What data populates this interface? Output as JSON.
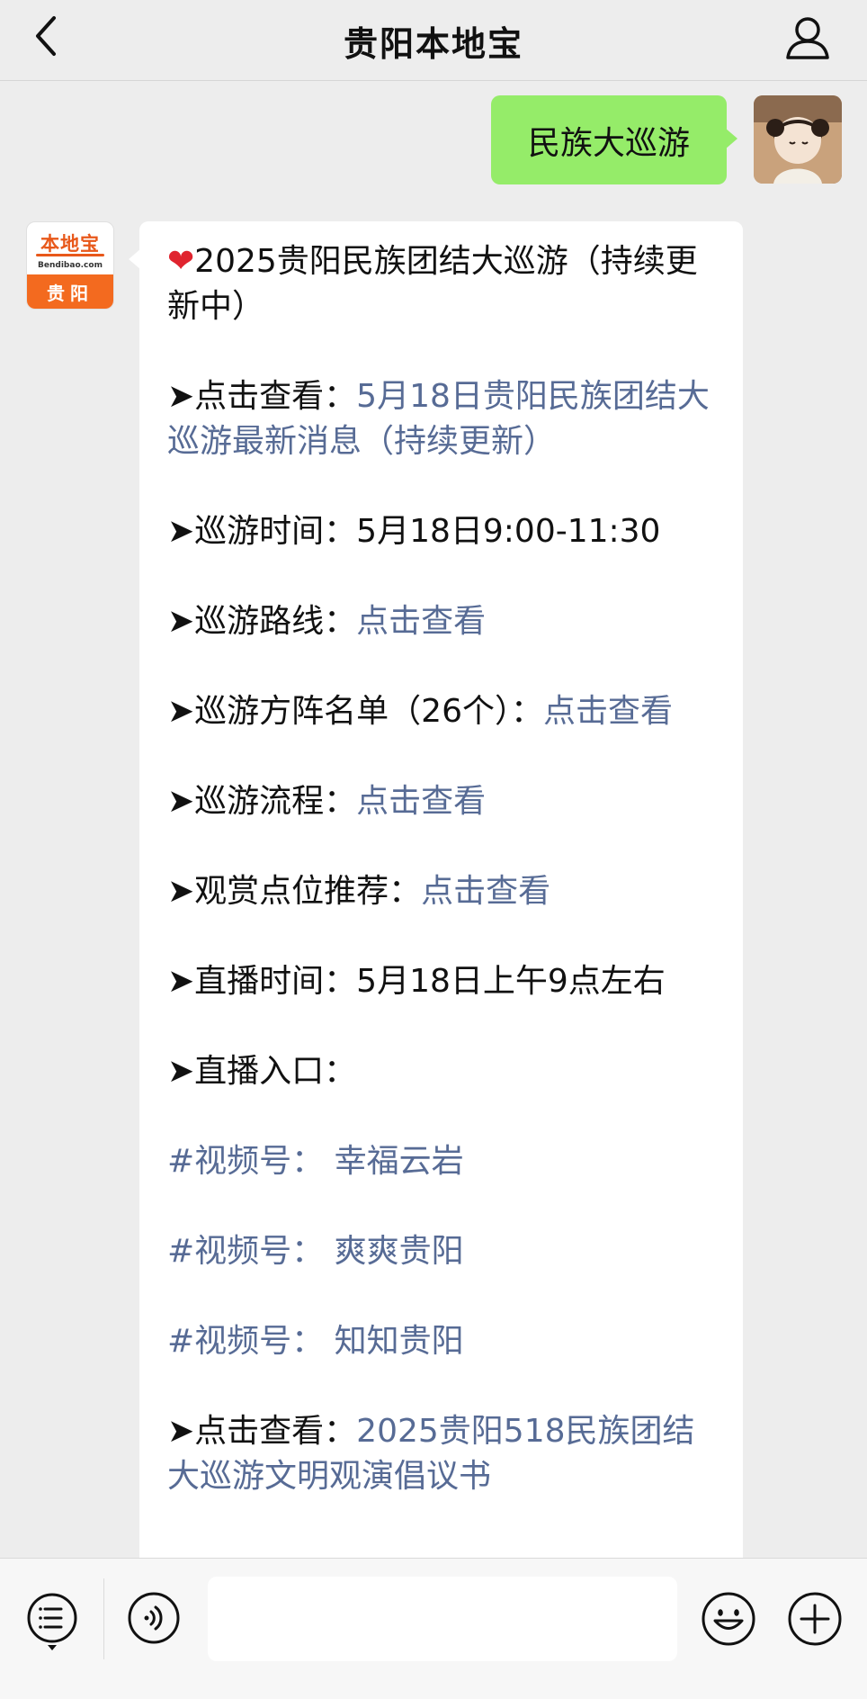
{
  "header": {
    "title": "贵阳本地宝"
  },
  "outgoing": {
    "text": "民族大巡游"
  },
  "incoming": {
    "avatar": {
      "logo_top": "本地宝",
      "logo_sub": "Bendibao.com",
      "logo_bottom": "贵阳"
    },
    "heading": "2025贵阳民族团结大巡游（持续更新中）",
    "items": [
      {
        "prefix": "➤点击查看：",
        "link": "5月18日贵阳民族团结大巡游最新消息（持续更新）"
      },
      {
        "prefix": "➤巡游时间：",
        "text": "5月18日9:00-11:30"
      },
      {
        "prefix": "➤巡游路线：",
        "link": "点击查看"
      },
      {
        "prefix": "➤巡游方阵名单（26个）：",
        "link": "点击查看"
      },
      {
        "prefix": "➤巡游流程：",
        "link": "点击查看"
      },
      {
        "prefix": "➤观赏点位推荐：",
        "link": "点击查看"
      },
      {
        "prefix": "➤直播时间：",
        "text": "5月18日上午9点左右"
      },
      {
        "prefix": "➤直播入口："
      },
      {
        "tag": "#视频号：",
        "text": "幸福云岩"
      },
      {
        "tag": "#视频号：",
        "text": "爽爽贵阳"
      },
      {
        "tag": "#视频号：",
        "text": "知知贵阳"
      },
      {
        "prefix": "➤点击查看：",
        "link": "2025贵阳518民族团结大巡游文明观演倡议书"
      }
    ]
  },
  "input_bar": {
    "placeholder": ""
  },
  "icons": {
    "back": "chevron-left-icon",
    "profile": "person-icon",
    "menu": "menu-list-icon",
    "voice": "voice-icon",
    "emoji": "emoji-icon",
    "plus": "plus-icon"
  },
  "colors": {
    "background": "#ededed",
    "outgoing_bubble": "#95ec69",
    "incoming_bubble": "#ffffff",
    "link": "#576b95",
    "brand_orange": "#f36a1f"
  }
}
